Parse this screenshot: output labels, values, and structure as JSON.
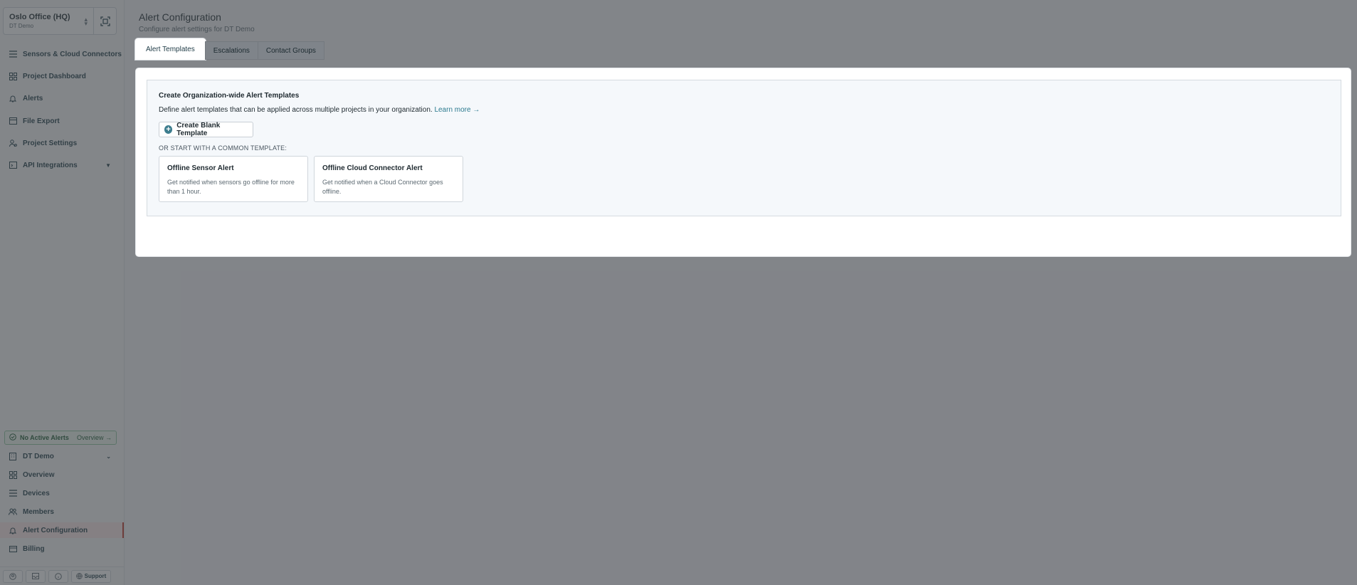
{
  "org": {
    "name": "Oslo Office (HQ)",
    "sub": "DT Demo"
  },
  "nav_top": [
    {
      "label": "Sensors & Cloud Connectors",
      "icon": "list-icon"
    },
    {
      "label": "Project Dashboard",
      "icon": "grid-icon"
    },
    {
      "label": "Alerts",
      "icon": "bell-icon"
    },
    {
      "label": "File Export",
      "icon": "calendar-icon"
    },
    {
      "label": "Project Settings",
      "icon": "user-gear-icon"
    },
    {
      "label": "API Integrations",
      "icon": "code-icon"
    }
  ],
  "alerts_pill": {
    "label": "No Active Alerts",
    "overview": "Overview →"
  },
  "nav_project": [
    {
      "label": "DT Demo",
      "icon": "building-icon"
    },
    {
      "label": "Overview",
      "icon": "grid-icon"
    },
    {
      "label": "Devices",
      "icon": "list-icon"
    },
    {
      "label": "Members",
      "icon": "users-icon"
    },
    {
      "label": "Alert Configuration",
      "icon": "bell-icon"
    },
    {
      "label": "Billing",
      "icon": "card-icon"
    }
  ],
  "bottom": {
    "support": "Support"
  },
  "page": {
    "title": "Alert Configuration",
    "subtitle": "Configure alert settings for DT Demo"
  },
  "tabs": [
    "Alert Templates",
    "Escalations",
    "Contact Groups"
  ],
  "card": {
    "title": "Create Organization-wide Alert Templates",
    "desc": "Define alert templates that can be applied across multiple projects in your organization.",
    "learn_more": "Learn more →",
    "blank_button": "Create Blank Template",
    "or_label": "OR START WITH A COMMON TEMPLATE:",
    "templates": [
      {
        "title": "Offline Sensor Alert",
        "desc": "Get notified when sensors go offline for more than 1 hour."
      },
      {
        "title": "Offline Cloud Connector Alert",
        "desc": "Get notified when a Cloud Connector goes offline."
      }
    ]
  }
}
